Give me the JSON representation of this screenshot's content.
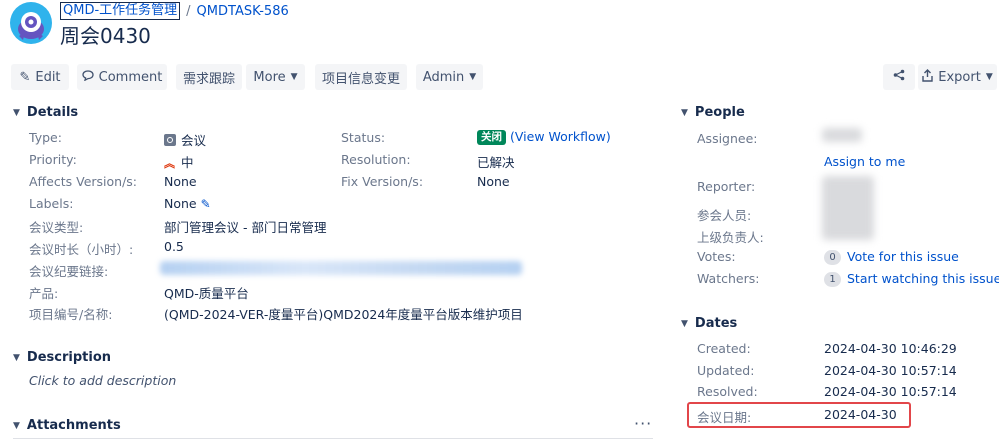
{
  "breadcrumb": {
    "project": "QMD-工作任务管理",
    "separator": "/",
    "issue_key": "QMDTASK-586"
  },
  "summary": "周会0430",
  "toolbar": {
    "edit": "Edit",
    "comment": "Comment",
    "req_tracking": "需求跟踪",
    "more": "More",
    "project_info_change": "项目信息变更",
    "admin": "Admin",
    "export": "Export"
  },
  "details": {
    "title": "Details",
    "type_label": "Type:",
    "type_value": "会议",
    "priority_label": "Priority:",
    "priority_value": "中",
    "affects_label": "Affects Version/s:",
    "affects_value": "None",
    "labels_label": "Labels:",
    "labels_value": "None",
    "meeting_type_label": "会议类型:",
    "meeting_type_value": "部门管理会议 - 部门日常管理",
    "duration_label": "会议时长（小时）:",
    "duration_value": "0.5",
    "minutes_link_label": "会议纪要链接:",
    "product_label": "产品:",
    "product_value": "QMD-质量平台",
    "project_no_label": "项目编号/名称:",
    "project_no_value": "(QMD-2024-VER-度量平台)QMD2024年度量平台版本维护项目",
    "status_label": "Status:",
    "status_value": "关闭",
    "status_link": "(View Workflow)",
    "resolution_label": "Resolution:",
    "resolution_value": "已解决",
    "fix_label": "Fix Version/s:",
    "fix_value": "None"
  },
  "description": {
    "title": "Description",
    "placeholder": "Click to add description"
  },
  "attachments": {
    "title": "Attachments",
    "more": "···"
  },
  "people": {
    "title": "People",
    "assignee_label": "Assignee:",
    "assign_to_me": "Assign to me",
    "reporter_label": "Reporter:",
    "participants_label": "参会人员:",
    "supervisor_label": "上级负责人:",
    "votes_label": "Votes:",
    "votes_count": "0",
    "votes_text": "Vote for this issue",
    "watchers_label": "Watchers:",
    "watchers_count": "1",
    "watchers_text": "Start watching this issue"
  },
  "dates": {
    "title": "Dates",
    "created_label": "Created:",
    "created_value": "2024-04-30 10:46:29",
    "updated_label": "Updated:",
    "updated_value": "2024-04-30 10:57:14",
    "resolved_label": "Resolved:",
    "resolved_value": "2024-04-30 10:57:14",
    "meeting_date_label": "会议日期:",
    "meeting_date_value": "2024-04-30"
  },
  "colors": {
    "link": "#0052cc",
    "status_done": "#00875a",
    "highlight": "#e2464a",
    "avatar": "#2fb3ec"
  },
  "icons": [
    "project-avatar-icon",
    "pencil-icon",
    "comment-icon",
    "share-icon",
    "export-icon",
    "meeting-type-icon",
    "priority-medium-icon",
    "edit-pencil-icon",
    "chevron-down-icon"
  ]
}
